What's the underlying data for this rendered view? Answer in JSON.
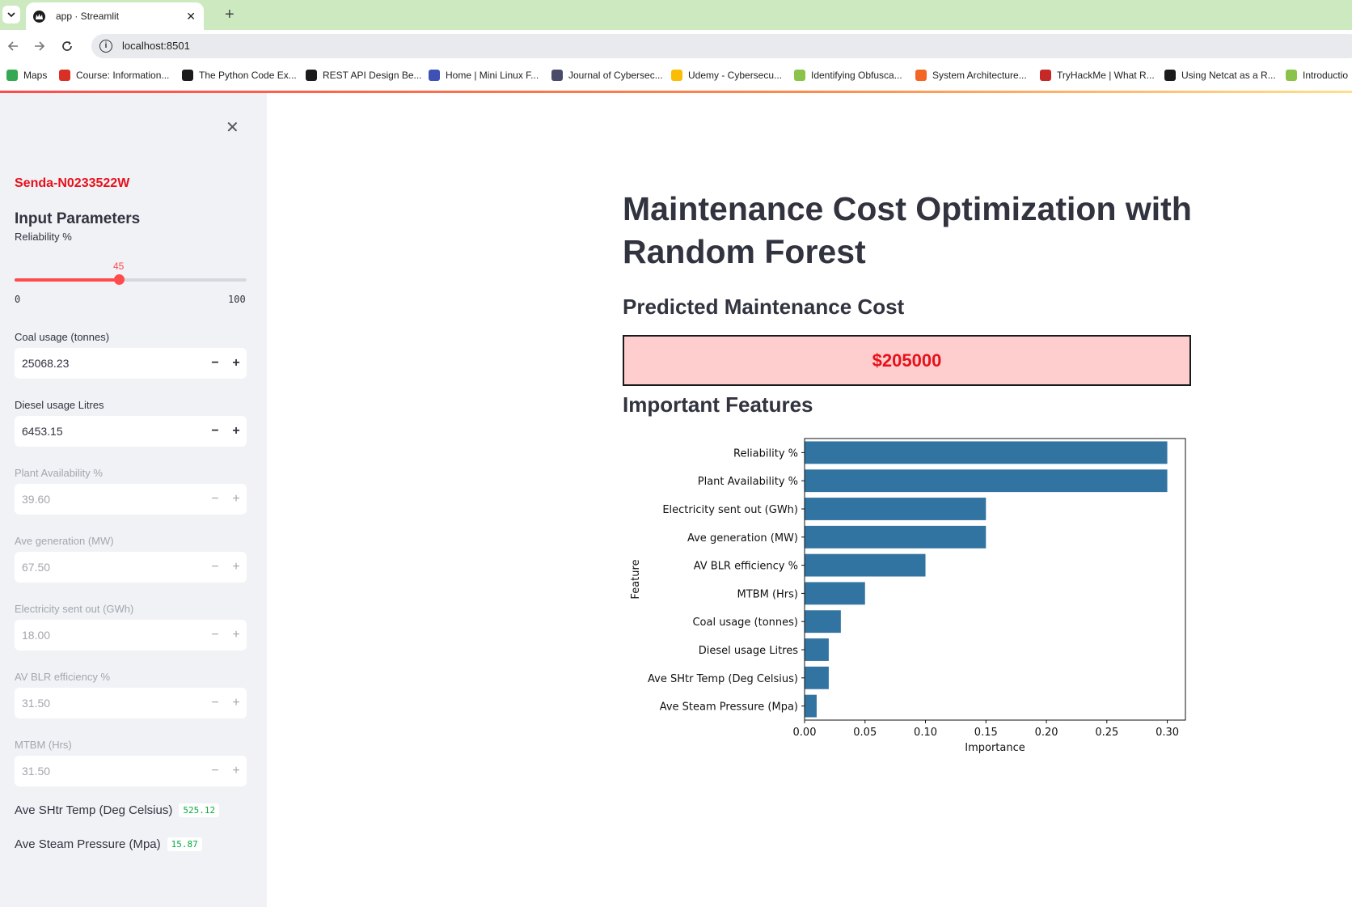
{
  "browser": {
    "tab_title": "app · Streamlit",
    "url": "localhost:8501",
    "bookmarks": [
      {
        "label": "Maps",
        "color": "#34a853"
      },
      {
        "label": "Course: Information...",
        "color": "#d93025"
      },
      {
        "label": "The Python Code Ex...",
        "color": "#1b1b1b"
      },
      {
        "label": "REST API Design Be...",
        "color": "#1b1b1b"
      },
      {
        "label": "Home | Mini Linux F...",
        "color": "#3f51b5"
      },
      {
        "label": "Journal of Cybersec...",
        "color": "#4a4a6a"
      },
      {
        "label": "Udemy - Cybersecu...",
        "color": "#fbbc04"
      },
      {
        "label": "Identifying Obfusca...",
        "color": "#8bc34a"
      },
      {
        "label": "System Architecture...",
        "color": "#f26522"
      },
      {
        "label": "TryHackMe | What R...",
        "color": "#c62828"
      },
      {
        "label": "Using Netcat as a R...",
        "color": "#1b1b1b"
      },
      {
        "label": "Introductio",
        "color": "#8bc34a"
      }
    ]
  },
  "sidebar": {
    "user_id": "Senda-N0233522W",
    "title": "Input Parameters",
    "slider": {
      "label": "Reliability %",
      "value": 45,
      "min": 0,
      "max": 100,
      "value_text": "45",
      "min_text": "0",
      "max_text": "100"
    },
    "inputs": [
      {
        "label": "Coal usage (tonnes)",
        "value": "25068.23",
        "disabled": false
      },
      {
        "label": "Diesel usage Litres",
        "value": "6453.15",
        "disabled": false
      },
      {
        "label": "Plant Availability %",
        "value": "39.60",
        "disabled": true
      },
      {
        "label": "Ave generation (MW)",
        "value": "67.50",
        "disabled": true
      },
      {
        "label": "Electricity sent out (GWh)",
        "value": "18.00",
        "disabled": true
      },
      {
        "label": "AV BLR efficiency %",
        "value": "31.50",
        "disabled": true
      },
      {
        "label": "MTBM (Hrs)",
        "value": "31.50",
        "disabled": true
      }
    ],
    "stepper_minus": "−",
    "stepper_plus": "+",
    "metrics": [
      {
        "label": "Ave SHtr Temp (Deg Celsius)",
        "value": "525.12"
      },
      {
        "label": "Ave Steam Pressure (Mpa)",
        "value": "15.87"
      }
    ]
  },
  "main": {
    "title": "Maintenance Cost Optimization with Random Forest",
    "cost_header": "Predicted Maintenance Cost",
    "cost_value": "$205000",
    "features_header": "Important Features"
  },
  "chart_data": {
    "type": "bar",
    "orientation": "horizontal",
    "categories": [
      "Reliability %",
      "Plant Availability %",
      "Electricity sent out (GWh)",
      "Ave generation (MW)",
      "AV BLR efficiency %",
      "MTBM (Hrs)",
      "Coal usage (tonnes)",
      "Diesel usage Litres",
      "Ave SHtr Temp (Deg Celsius)",
      "Ave Steam Pressure (Mpa)"
    ],
    "values": [
      0.3,
      0.3,
      0.15,
      0.15,
      0.1,
      0.05,
      0.03,
      0.02,
      0.02,
      0.01
    ],
    "xlabel": "Importance",
    "ylabel": "Feature",
    "xlim": [
      0,
      0.315
    ],
    "xticks": [
      "0.00",
      "0.05",
      "0.10",
      "0.15",
      "0.20",
      "0.25",
      "0.30"
    ],
    "bar_color": "#3274a1",
    "grid": false
  }
}
